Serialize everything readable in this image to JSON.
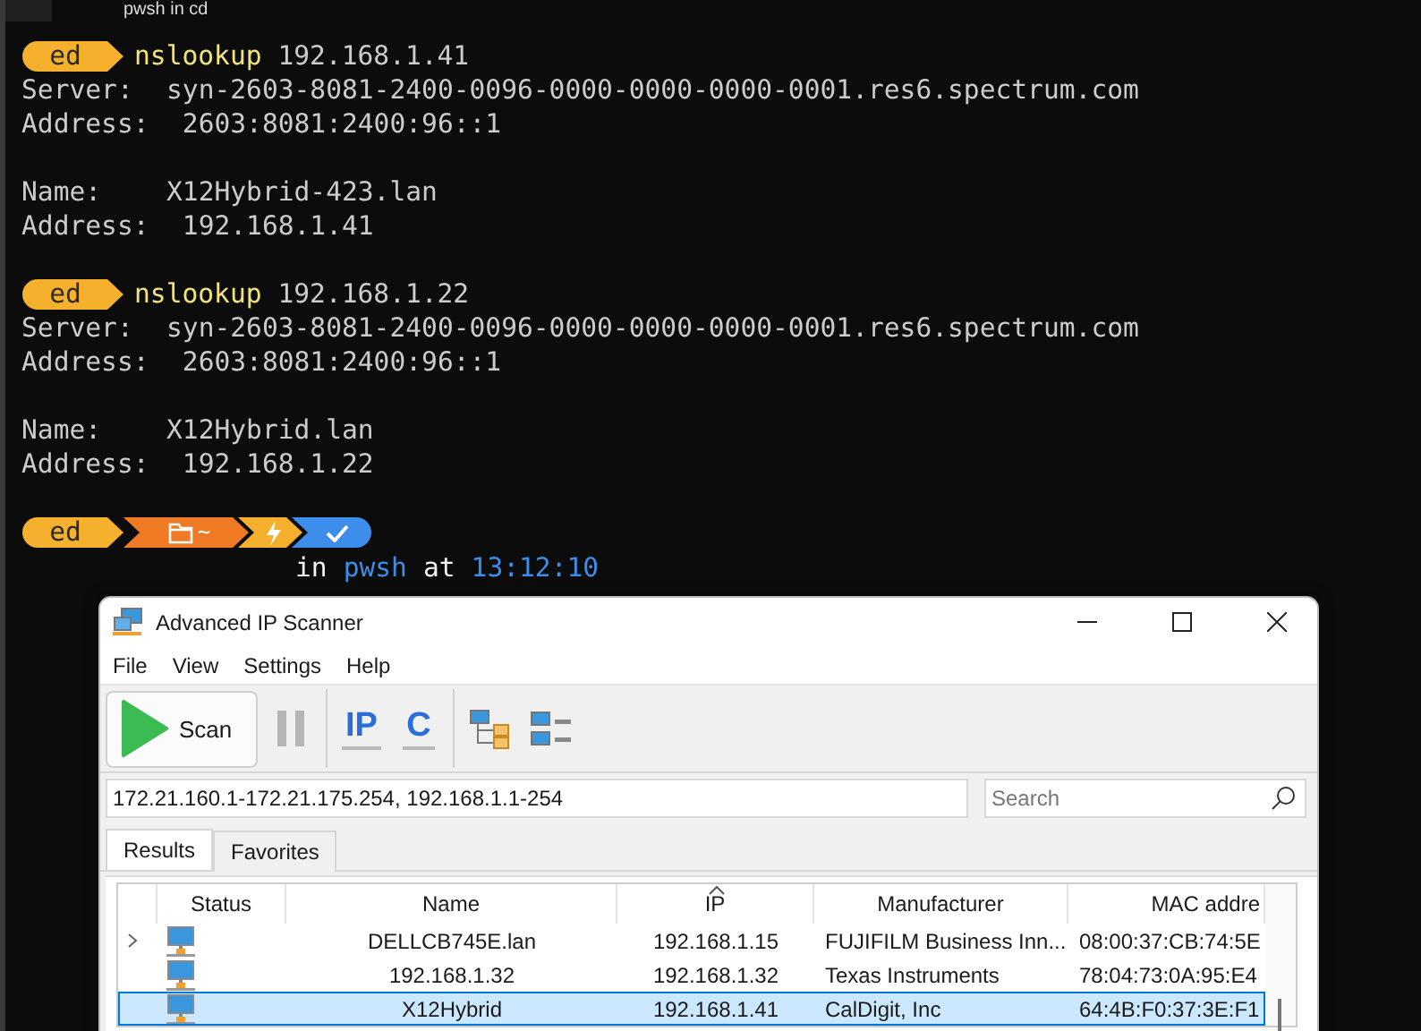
{
  "terminal": {
    "tab_title": "pwsh in cd",
    "blocks": [
      {
        "user": "ed",
        "command": "nslookup",
        "argument": "192.168.1.41",
        "groups": [
          [
            {
              "label": "Server:",
              "value": "syn-2603-8081-2400-0096-0000-0000-0000-0001.res6.spectrum.com"
            },
            {
              "label": "Address:",
              "value": " 2603:8081:2400:96::1"
            }
          ],
          [
            {
              "label": "Name:",
              "value": "X12Hybrid-423.lan"
            },
            {
              "label": "Address:",
              "value": " 192.168.1.41"
            }
          ]
        ]
      },
      {
        "user": "ed",
        "command": "nslookup",
        "argument": "192.168.1.22",
        "groups": [
          [
            {
              "label": "Server:",
              "value": "syn-2603-8081-2400-0096-0000-0000-0000-0001.res6.spectrum.com"
            },
            {
              "label": "Address:",
              "value": " 2603:8081:2400:96::1"
            }
          ],
          [
            {
              "label": "Name:",
              "value": "X12Hybrid.lan"
            },
            {
              "label": "Address:",
              "value": " 192.168.1.22"
            }
          ]
        ]
      }
    ],
    "final_prompt": {
      "user": "ed",
      "segments": [
        {
          "kind": "folder",
          "text": "~",
          "color": "#f07a24"
        },
        {
          "kind": "bolt",
          "color": "#f5b12e"
        },
        {
          "kind": "check",
          "color": "#3d8eea"
        }
      ],
      "status": [
        {
          "text": "in",
          "kind": "plain"
        },
        {
          "text": "pwsh",
          "kind": "shell"
        },
        {
          "text": "at",
          "kind": "plain"
        },
        {
          "text": "13:12:10",
          "kind": "time"
        }
      ]
    }
  },
  "scanner": {
    "title": "Advanced IP Scanner",
    "menu": [
      "File",
      "View",
      "Settings",
      "Help"
    ],
    "toolbar": {
      "scan_label": "Scan",
      "ip_icon_text": "IP",
      "c_icon_text": "C"
    },
    "range": "172.21.160.1-172.21.175.254, 192.168.1.1-254",
    "search": {
      "placeholder": "Search"
    },
    "tabs": [
      {
        "label": "Results",
        "selected": true
      },
      {
        "label": "Favorites",
        "selected": false
      }
    ],
    "columns": [
      {
        "label": "Status",
        "sorted": false
      },
      {
        "label": "Name",
        "sorted": false
      },
      {
        "label": "IP",
        "sorted": true
      },
      {
        "label": "Manufacturer",
        "sorted": false
      },
      {
        "label": "MAC addre",
        "sorted": false
      }
    ],
    "rows": [
      {
        "expandable": true,
        "selected": false,
        "name": "DELLCB745E.lan",
        "ip": "192.168.1.15",
        "manufacturer": "FUJIFILM Business Inn...",
        "mac": "08:00:37:CB:74:5E"
      },
      {
        "expandable": false,
        "selected": false,
        "name": "192.168.1.32",
        "ip": "192.168.1.32",
        "manufacturer": "Texas Instruments",
        "mac": "78:04:73:0A:95:E4"
      },
      {
        "expandable": false,
        "selected": true,
        "name": "X12Hybrid",
        "ip": "192.168.1.41",
        "manufacturer": "CalDigit, Inc",
        "mac": "64:4B:F0:37:3E:F1"
      }
    ]
  }
}
